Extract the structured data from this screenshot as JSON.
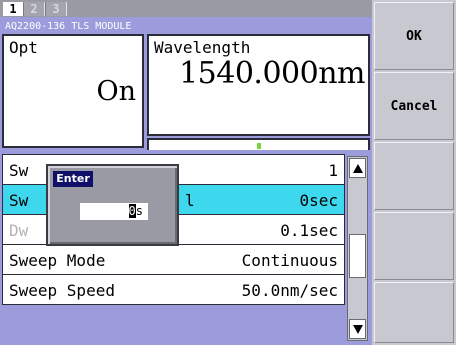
{
  "tabs": [
    {
      "label": "1",
      "active": true
    },
    {
      "label": "2",
      "active": false
    },
    {
      "label": "3",
      "active": false
    }
  ],
  "module_title": "AQ2200-136 TLS MODULE",
  "opt": {
    "label": "Opt",
    "value": "On"
  },
  "wavelength": {
    "label": "Wavelength",
    "value": "1540.000nm"
  },
  "params": [
    {
      "label": "Sw",
      "value": "1",
      "selected": false,
      "dim": false
    },
    {
      "label": "Sw",
      "value": "0sec",
      "selected": true,
      "dim": false
    },
    {
      "label": "Dw",
      "value": "0.1sec",
      "selected": false,
      "dim": true
    },
    {
      "label": "Sweep Mode",
      "value": "Continuous",
      "selected": false,
      "dim": false
    },
    {
      "label": "Sweep Speed",
      "value": "50.0nm/sec",
      "selected": false,
      "dim": false
    }
  ],
  "selected_row_extra": "l",
  "popup": {
    "title": "Enter",
    "input_cursor": "0",
    "input_unit": "s"
  },
  "softkeys": {
    "ok": "OK",
    "cancel": "Cancel"
  },
  "colors": {
    "panel": "#9c9cdc",
    "selected_row": "#3ed8ee",
    "popup_title": "#10106a",
    "marker": "#7ad43c"
  }
}
